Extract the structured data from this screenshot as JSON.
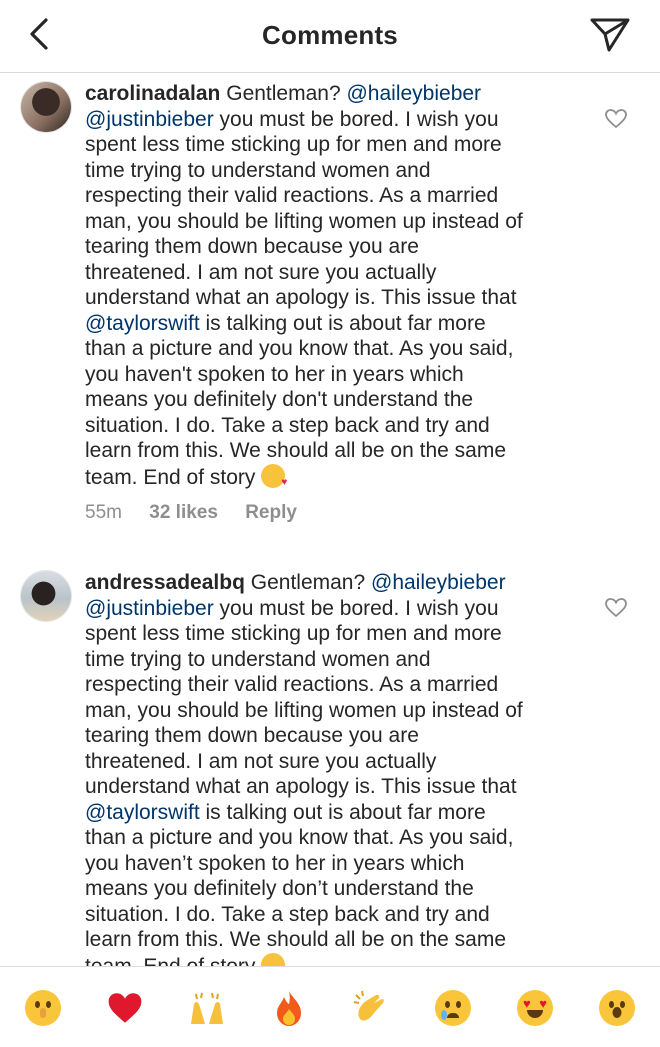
{
  "header": {
    "title": "Comments"
  },
  "comments": [
    {
      "username": "carolinadalan",
      "lines": [
        [
          "Gentleman? ",
          "@haileybieber"
        ],
        [
          "@justinbieber",
          " you must be bored. I wish you"
        ],
        [
          "spent less time sticking up for men and more"
        ],
        [
          "time trying to understand women and"
        ],
        [
          "respecting their valid reactions. As a married"
        ],
        [
          "man, you should be lifting women up instead of"
        ],
        [
          "tearing them down because you are"
        ],
        [
          "threatened. I am not sure you actually"
        ],
        [
          "understand what an apology is. This issue that"
        ],
        [
          "@taylorswift",
          " is talking out is about far more"
        ],
        [
          "than a picture and you know that. As you said,"
        ],
        [
          "you haven't spoken to her in years which"
        ],
        [
          "means you definitely don't understand the"
        ],
        [
          "situation. I do. Take a step back and try and"
        ],
        [
          "learn from this. We should all be on the same"
        ],
        [
          "team. End of story "
        ]
      ],
      "time": "55m",
      "likes": "32 likes",
      "reply": "Reply"
    },
    {
      "username": "andressadealbq",
      "lines": [
        [
          "Gentleman? ",
          "@haileybieber"
        ],
        [
          "@justinbieber",
          " you must be bored. I wish you"
        ],
        [
          "spent less time sticking up for men and more"
        ],
        [
          "time trying to understand women and"
        ],
        [
          "respecting their valid reactions. As a married"
        ],
        [
          "man, you should be lifting women up instead of"
        ],
        [
          "tearing them down because you are"
        ],
        [
          "threatened. I am not sure you actually"
        ],
        [
          "understand what an apology is. This issue that"
        ],
        [
          "@taylorswift",
          " is talking out is about far more"
        ],
        [
          "than a picture and you know that. As you said,"
        ],
        [
          "you haven’t spoken to her in years which"
        ],
        [
          "means you definitely don’t understand the"
        ],
        [
          "situation. I do. Take a step back and try and"
        ],
        [
          "learn from this. We should all be on the same"
        ],
        [
          "team. End of story "
        ]
      ]
    }
  ],
  "emoji_bar": [
    "shushing-face",
    "red-heart",
    "raising-hands",
    "fire",
    "clapping-hands",
    "crying-face",
    "heart-eyes-face",
    "surprised-face"
  ],
  "colors": {
    "text": "#262626",
    "mention": "#003569",
    "muted": "#8e8e8e",
    "divider": "#dbdbdb"
  }
}
